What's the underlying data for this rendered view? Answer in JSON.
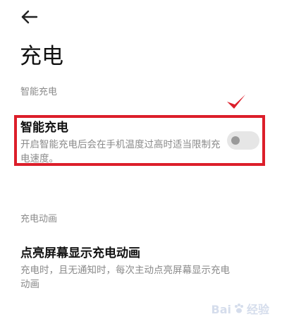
{
  "page": {
    "title": "充电",
    "back_icon": "arrow-left-icon"
  },
  "sections": [
    {
      "label": "智能充电",
      "settings": [
        {
          "title": "智能充电",
          "description": "开启智能充电后会在手机温度过高时适当限制充电速度。",
          "toggle_on": false
        }
      ]
    },
    {
      "label": "充电动画",
      "settings": [
        {
          "title": "点亮屏幕显示充电动画",
          "description": "充电时，且无通知时，每次主动点亮屏幕显示充电动画"
        }
      ]
    }
  ],
  "annotation": {
    "highlight_color": "#dc1e2a",
    "mark_icon": "red-checkmark-icon"
  },
  "watermark": {
    "text_left": "Bai",
    "text_right": "经验"
  },
  "colors": {
    "background": "#ffffff",
    "primary_text": "#111111",
    "secondary_text": "#8a8a8a",
    "toggle_track_off": "#e6e6e6",
    "toggle_knob_off": "#9a9a9a"
  }
}
